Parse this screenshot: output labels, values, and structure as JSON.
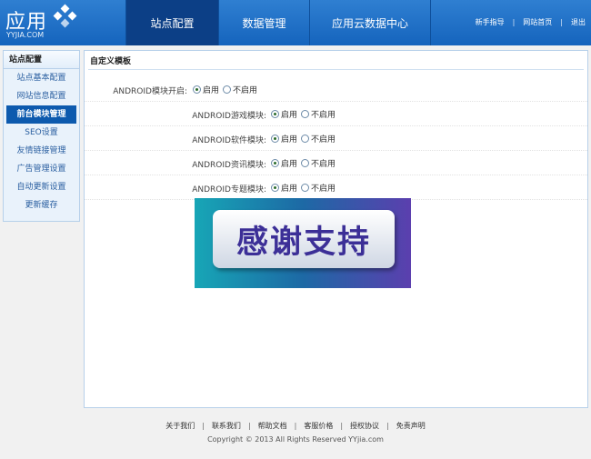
{
  "header": {
    "logo_text": "应用",
    "logo_sub": "YYJIA.COM",
    "nav": [
      {
        "label": "站点配置",
        "active": true
      },
      {
        "label": "数据管理",
        "active": false
      },
      {
        "label": "应用云数据中心",
        "active": false
      }
    ],
    "links": [
      "新手指导",
      "网站首页",
      "退出"
    ]
  },
  "sidebar": {
    "title": "站点配置",
    "items": [
      {
        "label": "站点基本配置",
        "active": false
      },
      {
        "label": "网站信息配置",
        "active": false
      },
      {
        "label": "前台模块管理",
        "active": true
      },
      {
        "label": "SEO设置",
        "active": false
      },
      {
        "label": "友情链接管理",
        "active": false
      },
      {
        "label": "广告管理设置",
        "active": false
      },
      {
        "label": "自动更新设置",
        "active": false
      },
      {
        "label": "更新缓存",
        "active": false
      }
    ]
  },
  "main": {
    "title": "自定义模板",
    "rows": [
      {
        "label": "ANDROID模块开启:",
        "enable": "启用",
        "disable": "不启用",
        "value": "enable"
      },
      {
        "label": "ANDROID游戏模块:",
        "enable": "启用",
        "disable": "不启用",
        "value": "enable"
      },
      {
        "label": "ANDROID软件模块:",
        "enable": "启用",
        "disable": "不启用",
        "value": "enable"
      },
      {
        "label": "ANDROID资讯模块:",
        "enable": "启用",
        "disable": "不启用",
        "value": "enable"
      },
      {
        "label": "ANDROID专题模块:",
        "enable": "启用",
        "disable": "不启用",
        "value": "enable"
      }
    ],
    "banner_text": "感谢支持"
  },
  "footer": {
    "links": [
      "关于我们",
      "联系我们",
      "帮助文档",
      "客服价格",
      "授权协议",
      "免责声明"
    ],
    "copyright": "Copyright © 2013 All Rights Reserved YYjia.com"
  },
  "colors": {
    "header_blue": "#1564bd",
    "active_nav": "#0c3f86",
    "sidebar_active": "#0d5aae",
    "banner_text": "#3c2f97"
  }
}
